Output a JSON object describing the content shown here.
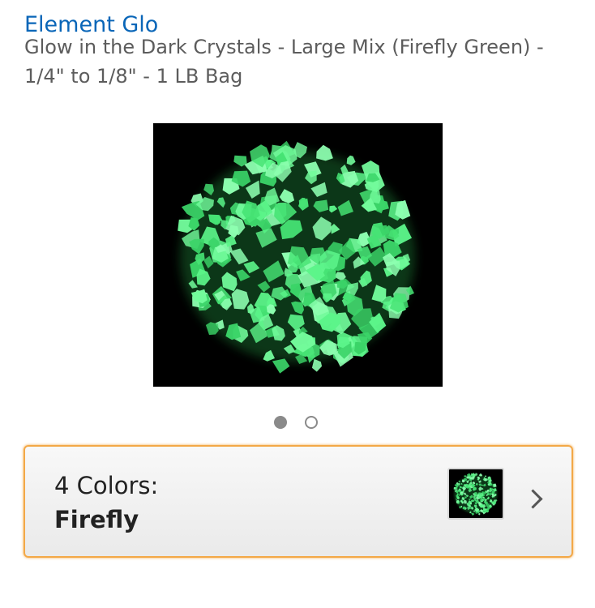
{
  "product": {
    "brand": "Element Glo",
    "title": "Glow in the Dark Crystals - Large Mix (Firefly Green) - 1/4\" to 1/8\" - 1 LB Bag"
  },
  "gallery": {
    "total_images": 2,
    "current_index": 1
  },
  "variation": {
    "label": "4 Colors:",
    "selected": "Firefly"
  },
  "icons": {
    "carousel_active": "filled-circle",
    "carousel_inactive": "hollow-circle",
    "chevron": "chevron-right-icon"
  },
  "colors": {
    "brand_link": "#0a66b8",
    "title_text": "#5c5c5c",
    "selection_border": "#f3a847",
    "crystal_glow": "#4ef07a"
  }
}
